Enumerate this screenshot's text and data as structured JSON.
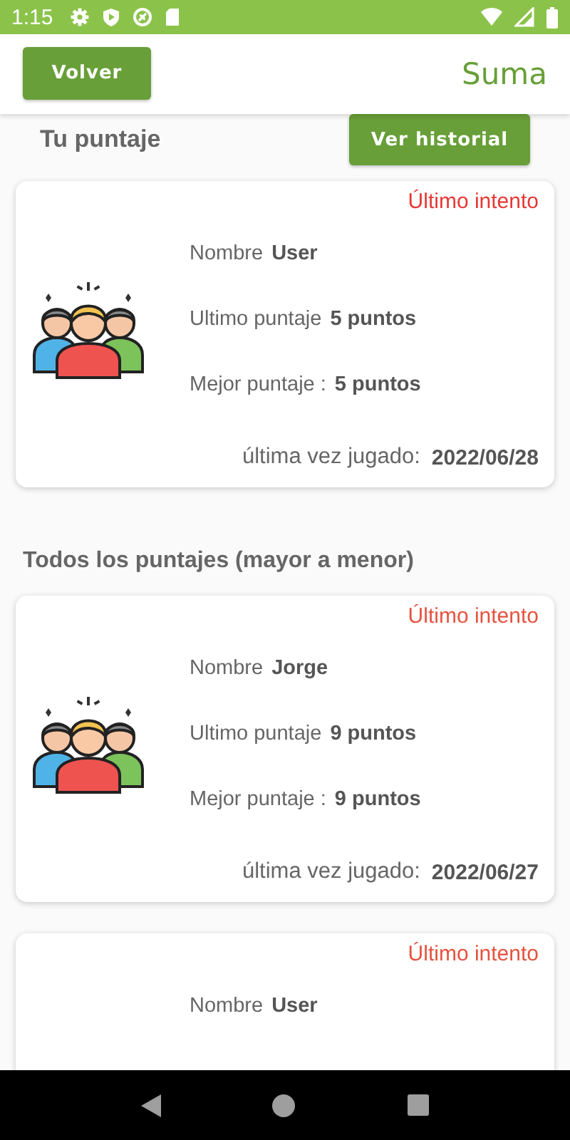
{
  "status_bar": {
    "time": "1:15"
  },
  "app_bar": {
    "back_button": "Volver",
    "title": "Suma"
  },
  "your_score": {
    "title": "Tu puntaje",
    "history_button": "Ver historial"
  },
  "your_card": {
    "badge": "Último intento",
    "color": "#e53935",
    "name_label": "Nombre",
    "name": "User",
    "last_score_label": "Ultimo puntaje",
    "last_score": "5 puntos",
    "best_score_label": "Mejor puntaje :",
    "best_score": "5 puntos",
    "date_label": "última vez jugado:",
    "date": "2022/06/28"
  },
  "all_scores": {
    "title": "Todos los puntajes (mayor a menor)",
    "cards": [
      {
        "badge": "Último intento",
        "color": "#e5533f",
        "name_label": "Nombre",
        "name": "Jorge",
        "last_score_label": "Ultimo puntaje",
        "last_score": "9 puntos",
        "best_score_label": "Mejor puntaje :",
        "best_score": "9 puntos",
        "date_label": "última vez jugado:",
        "date": "2022/06/27"
      },
      {
        "badge": "Último intento",
        "color": "#e5533f",
        "name_label": "Nombre",
        "name": "User"
      }
    ]
  }
}
